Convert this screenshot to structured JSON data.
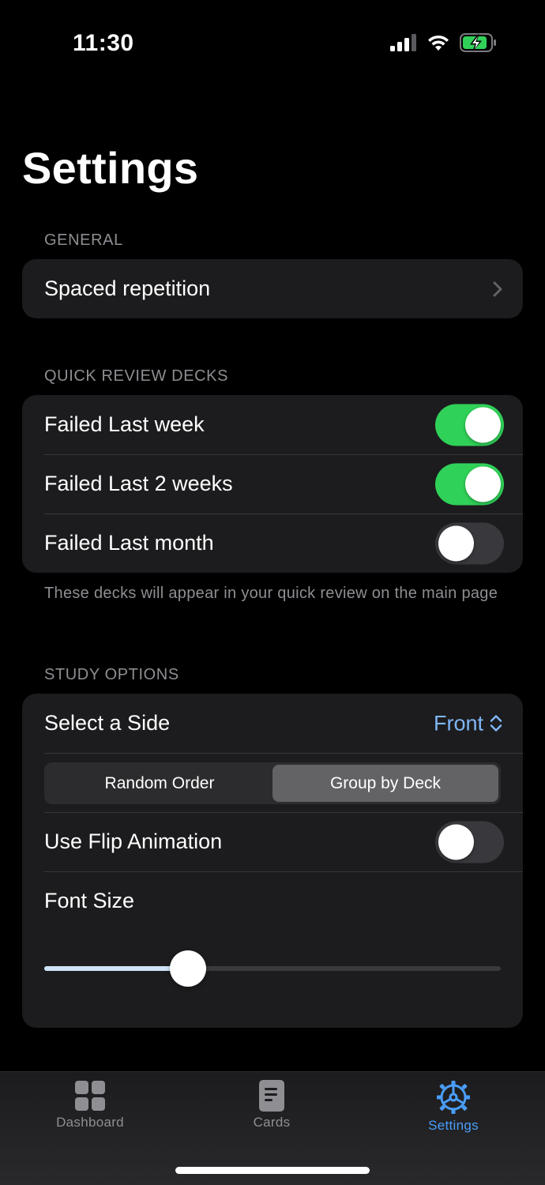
{
  "status_bar": {
    "time": "11:30"
  },
  "page": {
    "title": "Settings"
  },
  "general": {
    "header": "GENERAL",
    "spaced_repetition_label": "Spaced repetition"
  },
  "quick_review": {
    "header": "QUICK REVIEW DECKS",
    "items": [
      {
        "label": "Failed Last week",
        "enabled": true
      },
      {
        "label": "Failed Last 2 weeks",
        "enabled": true
      },
      {
        "label": "Failed Last month",
        "enabled": false
      }
    ],
    "footnote": "These decks will appear in your quick review on the main page"
  },
  "study_options": {
    "header": "STUDY OPTIONS",
    "select_side_label": "Select a Side",
    "select_side_value": "Front",
    "order_options": [
      "Random Order",
      "Group by Deck"
    ],
    "order_selected": "Group by Deck",
    "flip_animation_label": "Use Flip Animation",
    "flip_animation_enabled": false,
    "font_size_label": "Font Size",
    "font_size_fraction": 0.315
  },
  "tab_bar": {
    "tabs": [
      {
        "label": "Dashboard",
        "icon": "grid-icon",
        "active": false
      },
      {
        "label": "Cards",
        "icon": "card-icon",
        "active": false
      },
      {
        "label": "Settings",
        "icon": "gear-icon",
        "active": true
      }
    ]
  },
  "colors": {
    "accent": "#4a9df8",
    "toggle_on": "#30d158",
    "select_value": "#7fb6f5",
    "background": "#000000",
    "group_background": "#1c1c1e"
  }
}
